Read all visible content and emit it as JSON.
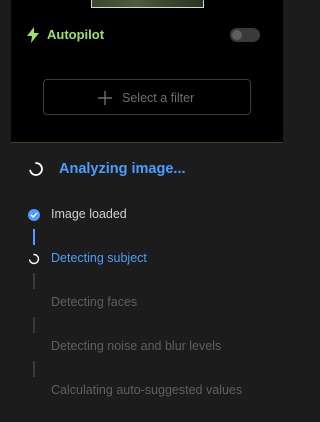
{
  "autopilot": {
    "label": "Autopilot",
    "enabled": false,
    "accent_color": "#9fe35c"
  },
  "filter": {
    "label": "Select a filter",
    "icon": "plus-icon"
  },
  "analysis": {
    "title": "Analyzing image...",
    "accent_color": "#4a9eff",
    "steps": [
      {
        "label": "Image loaded",
        "status": "done"
      },
      {
        "label": "Detecting subject",
        "status": "active"
      },
      {
        "label": "Detecting faces",
        "status": "pending"
      },
      {
        "label": "Detecting noise and blur levels",
        "status": "pending"
      },
      {
        "label": "Calculating auto-suggested values",
        "status": "pending"
      }
    ]
  }
}
